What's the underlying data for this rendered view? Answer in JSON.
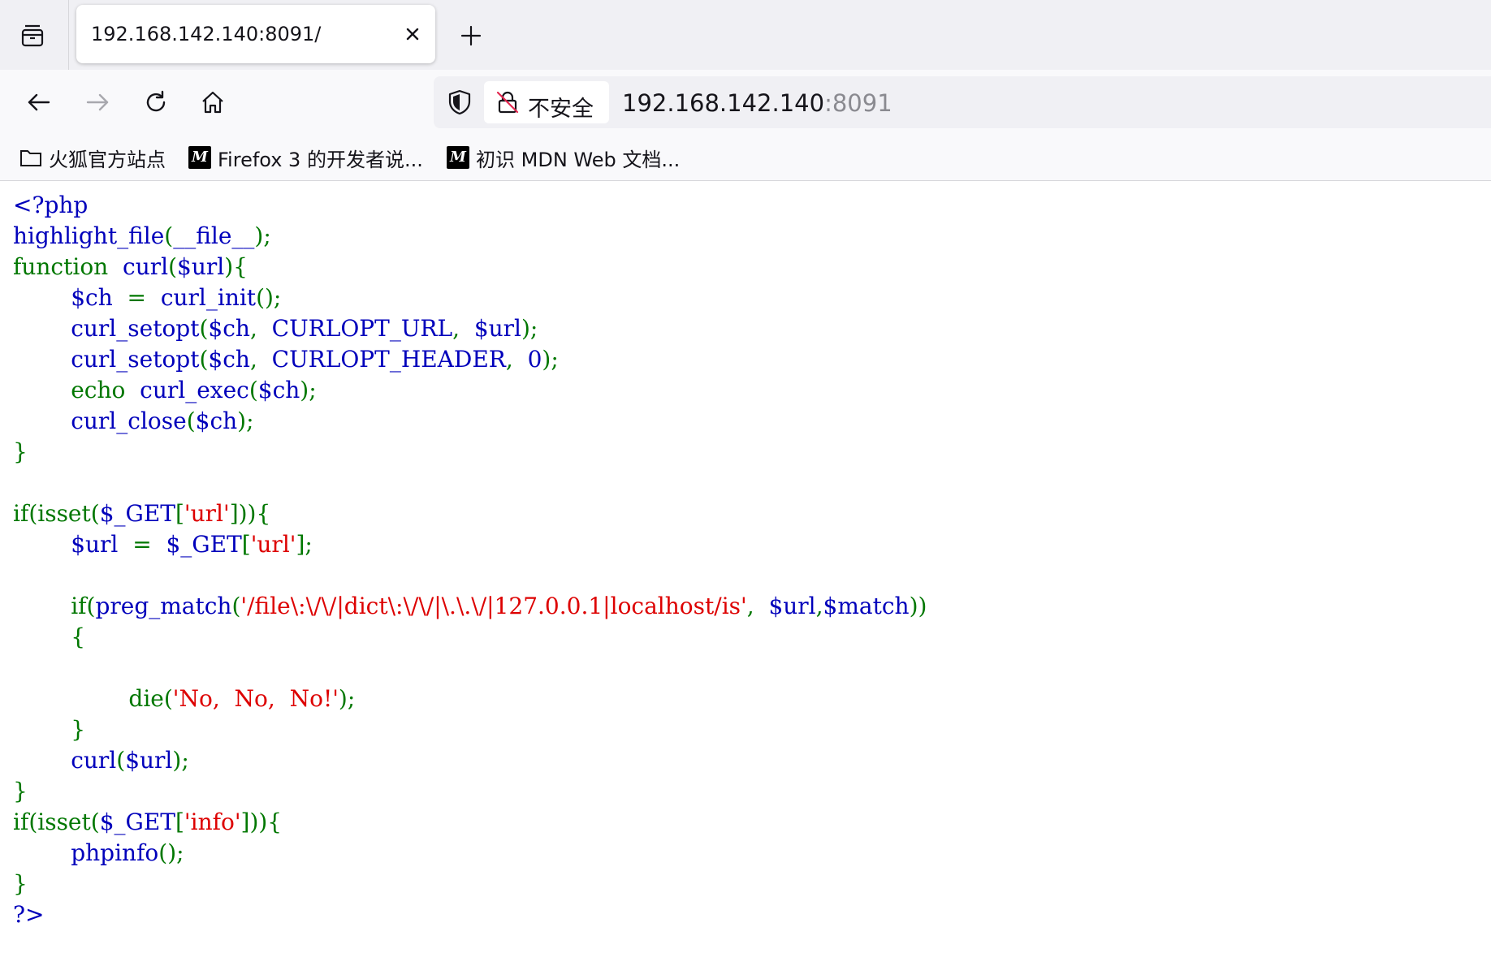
{
  "browser": {
    "tab_title": "192.168.142.140:8091/",
    "security_label": "不安全",
    "url_host": "192.168.142.140",
    "url_port": ":8091"
  },
  "bookmarks": [
    {
      "label": "火狐官方站点",
      "icon": "folder-icon"
    },
    {
      "label": "Firefox 3 的开发者说...",
      "icon": "mdn-icon"
    },
    {
      "label": "初识 MDN Web 文档...",
      "icon": "mdn-icon"
    }
  ],
  "colors": {
    "keyword": "#007700",
    "default": "#0000bb",
    "string": "#dd0000"
  },
  "code": [
    [
      {
        "t": "<?php",
        "c": "d"
      }
    ],
    [
      {
        "t": "highlight_file",
        "c": "d"
      },
      {
        "t": "(",
        "c": "k"
      },
      {
        "t": "__file__",
        "c": "d"
      },
      {
        "t": ");",
        "c": "k"
      }
    ],
    [
      {
        "t": "function  ",
        "c": "k"
      },
      {
        "t": "curl",
        "c": "d"
      },
      {
        "t": "(",
        "c": "k"
      },
      {
        "t": "$url",
        "c": "d"
      },
      {
        "t": "){",
        "c": "k"
      }
    ],
    [
      {
        "t": "        ",
        "c": "d"
      },
      {
        "t": "$ch  ",
        "c": "d"
      },
      {
        "t": "=  ",
        "c": "k"
      },
      {
        "t": "curl_init",
        "c": "d"
      },
      {
        "t": "();",
        "c": "k"
      }
    ],
    [
      {
        "t": "        ",
        "c": "d"
      },
      {
        "t": "curl_setopt",
        "c": "d"
      },
      {
        "t": "(",
        "c": "k"
      },
      {
        "t": "$ch",
        "c": "d"
      },
      {
        "t": ",  ",
        "c": "k"
      },
      {
        "t": "CURLOPT_URL",
        "c": "d"
      },
      {
        "t": ",  ",
        "c": "k"
      },
      {
        "t": "$url",
        "c": "d"
      },
      {
        "t": ");",
        "c": "k"
      }
    ],
    [
      {
        "t": "        ",
        "c": "d"
      },
      {
        "t": "curl_setopt",
        "c": "d"
      },
      {
        "t": "(",
        "c": "k"
      },
      {
        "t": "$ch",
        "c": "d"
      },
      {
        "t": ",  ",
        "c": "k"
      },
      {
        "t": "CURLOPT_HEADER",
        "c": "d"
      },
      {
        "t": ",  ",
        "c": "k"
      },
      {
        "t": "0",
        "c": "d"
      },
      {
        "t": ");",
        "c": "k"
      }
    ],
    [
      {
        "t": "        ",
        "c": "d"
      },
      {
        "t": "echo  ",
        "c": "k"
      },
      {
        "t": "curl_exec",
        "c": "d"
      },
      {
        "t": "(",
        "c": "k"
      },
      {
        "t": "$ch",
        "c": "d"
      },
      {
        "t": ");",
        "c": "k"
      }
    ],
    [
      {
        "t": "        ",
        "c": "d"
      },
      {
        "t": "curl_close",
        "c": "d"
      },
      {
        "t": "(",
        "c": "k"
      },
      {
        "t": "$ch",
        "c": "d"
      },
      {
        "t": ");",
        "c": "k"
      }
    ],
    [
      {
        "t": "}",
        "c": "k"
      }
    ],
    [
      {
        "t": "",
        "c": "d"
      }
    ],
    [
      {
        "t": "if(isset(",
        "c": "k"
      },
      {
        "t": "$_GET",
        "c": "d"
      },
      {
        "t": "[",
        "c": "k"
      },
      {
        "t": "'url'",
        "c": "s"
      },
      {
        "t": "])){",
        "c": "k"
      }
    ],
    [
      {
        "t": "        ",
        "c": "d"
      },
      {
        "t": "$url  ",
        "c": "d"
      },
      {
        "t": "=  ",
        "c": "k"
      },
      {
        "t": "$_GET",
        "c": "d"
      },
      {
        "t": "[",
        "c": "k"
      },
      {
        "t": "'url'",
        "c": "s"
      },
      {
        "t": "];",
        "c": "k"
      }
    ],
    [
      {
        "t": "",
        "c": "d"
      }
    ],
    [
      {
        "t": "        ",
        "c": "d"
      },
      {
        "t": "if(",
        "c": "k"
      },
      {
        "t": "preg_match",
        "c": "d"
      },
      {
        "t": "(",
        "c": "k"
      },
      {
        "t": "'/file\\:\\/\\/|dict\\:\\/\\/|\\.\\.\\/|127.0.0.1|localhost/is'",
        "c": "s"
      },
      {
        "t": ",  ",
        "c": "k"
      },
      {
        "t": "$url",
        "c": "d"
      },
      {
        "t": ",",
        "c": "k"
      },
      {
        "t": "$match",
        "c": "d"
      },
      {
        "t": "))",
        "c": "k"
      }
    ],
    [
      {
        "t": "        ",
        "c": "d"
      },
      {
        "t": "{",
        "c": "k"
      }
    ],
    [
      {
        "t": "",
        "c": "d"
      }
    ],
    [
      {
        "t": "                ",
        "c": "d"
      },
      {
        "t": "die(",
        "c": "k"
      },
      {
        "t": "'No,  No,  No!'",
        "c": "s"
      },
      {
        "t": ");",
        "c": "k"
      }
    ],
    [
      {
        "t": "        ",
        "c": "d"
      },
      {
        "t": "}",
        "c": "k"
      }
    ],
    [
      {
        "t": "        ",
        "c": "d"
      },
      {
        "t": "curl",
        "c": "d"
      },
      {
        "t": "(",
        "c": "k"
      },
      {
        "t": "$url",
        "c": "d"
      },
      {
        "t": ");",
        "c": "k"
      }
    ],
    [
      {
        "t": "}",
        "c": "k"
      }
    ],
    [
      {
        "t": "if(isset(",
        "c": "k"
      },
      {
        "t": "$_GET",
        "c": "d"
      },
      {
        "t": "[",
        "c": "k"
      },
      {
        "t": "'info'",
        "c": "s"
      },
      {
        "t": "])){",
        "c": "k"
      }
    ],
    [
      {
        "t": "        ",
        "c": "d"
      },
      {
        "t": "phpinfo",
        "c": "d"
      },
      {
        "t": "();",
        "c": "k"
      }
    ],
    [
      {
        "t": "}",
        "c": "k"
      }
    ],
    [
      {
        "t": "?>",
        "c": "d"
      }
    ]
  ]
}
